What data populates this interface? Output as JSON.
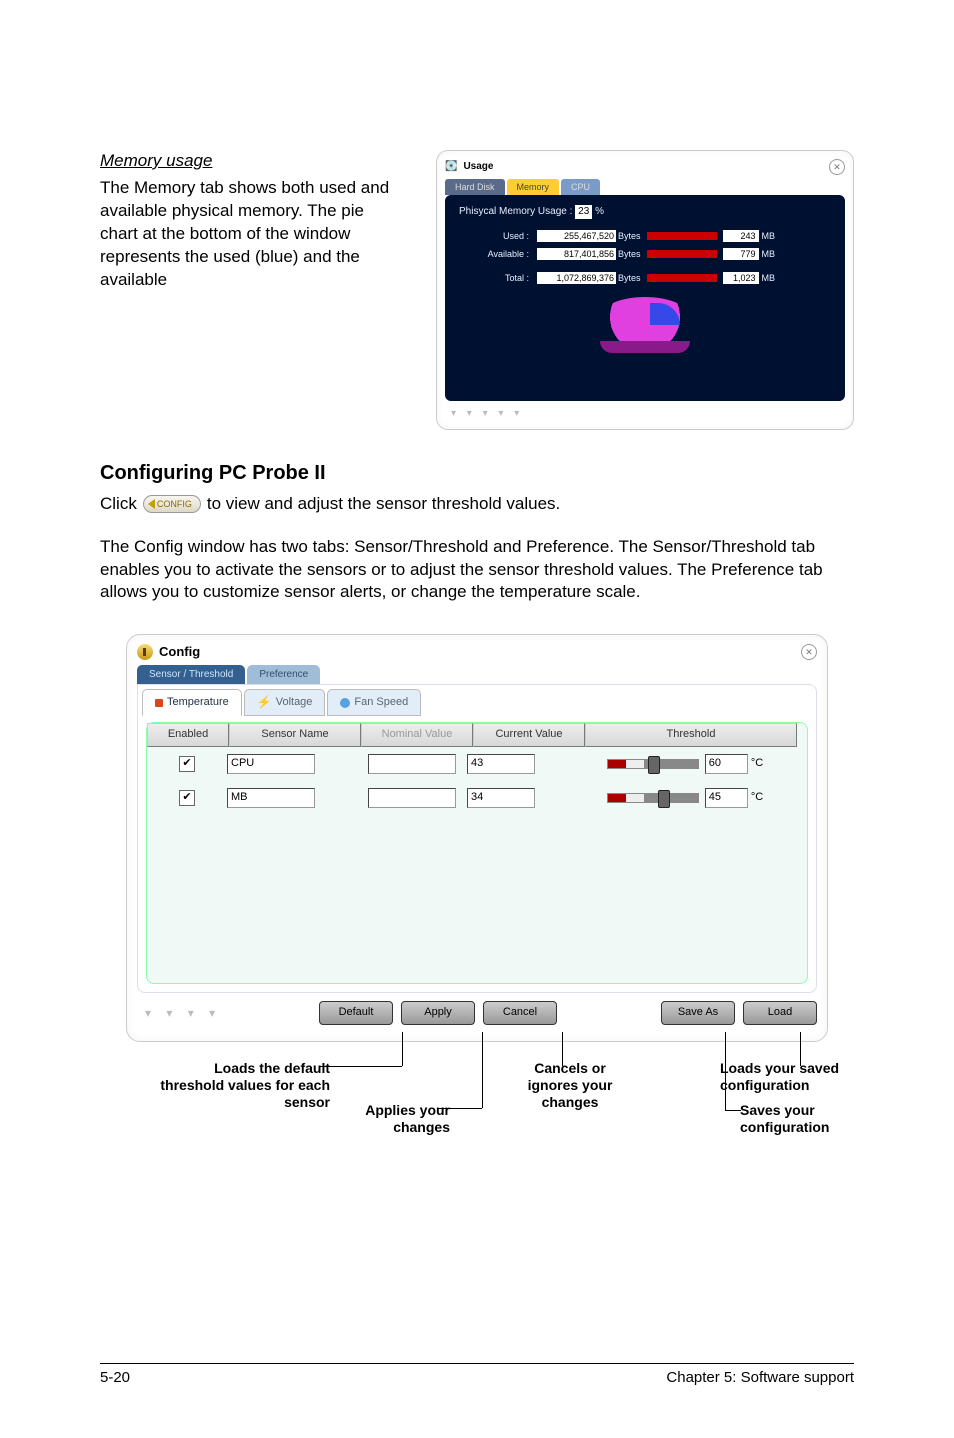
{
  "memory": {
    "title": "Memory usage",
    "body": "The Memory tab shows both used and available physical memory. The pie chart at the bottom of the window represents the used (blue) and the available",
    "panel": {
      "title": "Usage",
      "tabs": {
        "hd": "Hard Disk",
        "mem": "Memory",
        "cpu": "CPU"
      },
      "percent_label": "Phisycal Memory Usage :",
      "percent_value": "23",
      "percent_suffix": "%",
      "used_label": "Used :",
      "used_value": "255,467,520",
      "used_unit": "Bytes",
      "used_mb": "243",
      "avail_label": "Available :",
      "avail_value": "817,401,856",
      "avail_unit": "Bytes",
      "avail_mb": "779",
      "total_label": "Total :",
      "total_value": "1,072,869,376",
      "total_unit": "Bytes",
      "total_mb": "1,023",
      "mb": "MB"
    }
  },
  "section2": {
    "title": "Configuring PC Probe II",
    "click_prefix": "Click",
    "config_label": "CONFIG",
    "click_suffix": "to view and adjust the sensor threshold values.",
    "paragraph": "The Config window has two tabs: Sensor/Threshold and Preference. The Sensor/Threshold tab enables you to activate the sensors or to adjust the sensor threshold values. The Preference tab allows you to customize sensor alerts, or change the temperature scale."
  },
  "config": {
    "title": "Config",
    "top_tabs": {
      "st": "Sensor / Threshold",
      "pref": "Preference"
    },
    "sub_tabs": {
      "temp": "Temperature",
      "volt": "Voltage",
      "fan": "Fan Speed"
    },
    "columns": {
      "enabled": "Enabled",
      "sensor": "Sensor Name",
      "nominal": "Nominal Value",
      "current": "Current Value",
      "threshold": "Threshold"
    },
    "rows": [
      {
        "name": "CPU",
        "current": "43",
        "threshold": "60",
        "unit": "C"
      },
      {
        "name": "MB",
        "current": "34",
        "threshold": "45",
        "unit": "C"
      }
    ],
    "buttons": {
      "default": "Default",
      "apply": "Apply",
      "cancel": "Cancel",
      "saveas": "Save As",
      "load": "Load"
    }
  },
  "annotations": {
    "default": "Loads the default threshold values for each sensor",
    "apply": "Applies your changes",
    "cancel": "Cancels or ignores your changes",
    "load": "Loads your saved configuration",
    "saveas": "Saves your configuration"
  },
  "footer": {
    "left": "5-20",
    "right": "Chapter 5: Software support"
  }
}
